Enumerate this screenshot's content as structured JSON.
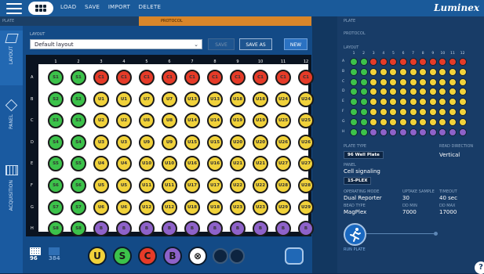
{
  "topbar": {
    "menu": [
      "LOAD",
      "SAVE",
      "IMPORT",
      "DELETE"
    ],
    "brand": "Luminex"
  },
  "tabstrip": {
    "left_label": "PLATE",
    "orange_label": "PROTOCOL"
  },
  "sidebar": {
    "items": [
      {
        "label": "LAYOUT"
      },
      {
        "label": "PANEL"
      },
      {
        "label": "ACQUISITION"
      }
    ]
  },
  "layout": {
    "section_label": "LAYOUT",
    "selected": "Default layout",
    "buttons": {
      "save": "SAVE",
      "save_as": "SAVE AS",
      "new": "NEW"
    }
  },
  "plate": {
    "columns": [
      "1",
      "2",
      "3",
      "4",
      "5",
      "6",
      "7",
      "8",
      "9",
      "10",
      "11",
      "12"
    ],
    "rows": [
      "A",
      "B",
      "C",
      "D",
      "E",
      "F",
      "G",
      "H"
    ],
    "wells": [
      [
        "S1",
        "S1",
        "C1",
        "C1",
        "C1",
        "C1",
        "C1",
        "C1",
        "C1",
        "C1",
        "C1",
        "C1"
      ],
      [
        "S2",
        "S2",
        "U1",
        "U1",
        "U7",
        "U7",
        "U13",
        "U13",
        "U18",
        "U18",
        "U24",
        "U24"
      ],
      [
        "S3",
        "S3",
        "U2",
        "U2",
        "U8",
        "U8",
        "U14",
        "U14",
        "U19",
        "U19",
        "U25",
        "U25"
      ],
      [
        "S4",
        "S4",
        "U3",
        "U3",
        "U9",
        "U9",
        "U15",
        "U15",
        "U20",
        "U20",
        "U26",
        "U26"
      ],
      [
        "S5",
        "S5",
        "U4",
        "U4",
        "U10",
        "U10",
        "U16",
        "U16",
        "U21",
        "U21",
        "U27",
        "U27"
      ],
      [
        "S6",
        "S6",
        "U5",
        "U5",
        "U11",
        "U11",
        "U17",
        "U17",
        "U22",
        "U22",
        "U28",
        "U28"
      ],
      [
        "S7",
        "S7",
        "U6",
        "U6",
        "U12",
        "U12",
        "U18",
        "U18",
        "U23",
        "U23",
        "U29",
        "U29"
      ],
      [
        "S8",
        "S8",
        "B",
        "B",
        "B",
        "B",
        "B",
        "B",
        "B",
        "B",
        "B",
        "B"
      ]
    ],
    "well_colors": {
      "S": "#3cc24a",
      "C": "#e63b28",
      "U": "#f1d23a",
      "B": "#8e62c9"
    }
  },
  "bottom": {
    "sizes": [
      "96",
      "384"
    ],
    "chips": [
      "U",
      "S",
      "C",
      "B",
      "⊗"
    ]
  },
  "right": {
    "plate_label": "PLATE",
    "protocol_label": "PROTOCOL",
    "layout_label": "LAYOUT",
    "mini_rows": [
      "A",
      "B",
      "C",
      "D",
      "E",
      "F",
      "G",
      "H"
    ],
    "plate_type_label": "PLATE TYPE",
    "plate_type": "96 Well Plate",
    "read_dir_label": "READ DIRECTION",
    "read_dir": "Vertical",
    "panel_label": "PANEL",
    "panel_name": "Cell signaling",
    "panel_tag": "15-PLEX",
    "op_mode_label": "OPERATING MODE",
    "op_mode": "Dual Reporter",
    "uptake_label": "UPTAKE SAMPLE",
    "uptake": "30",
    "timeout_label": "TIMEOUT",
    "timeout": "40 sec",
    "bead_type_label": "BEAD TYPE",
    "bead_type": "MagPlex",
    "dd_min_label": "DD MIN",
    "dd_min": "7000",
    "dd_max_label": "DD MAX",
    "dd_max": "17000",
    "run_label": "RUN PLATE"
  }
}
